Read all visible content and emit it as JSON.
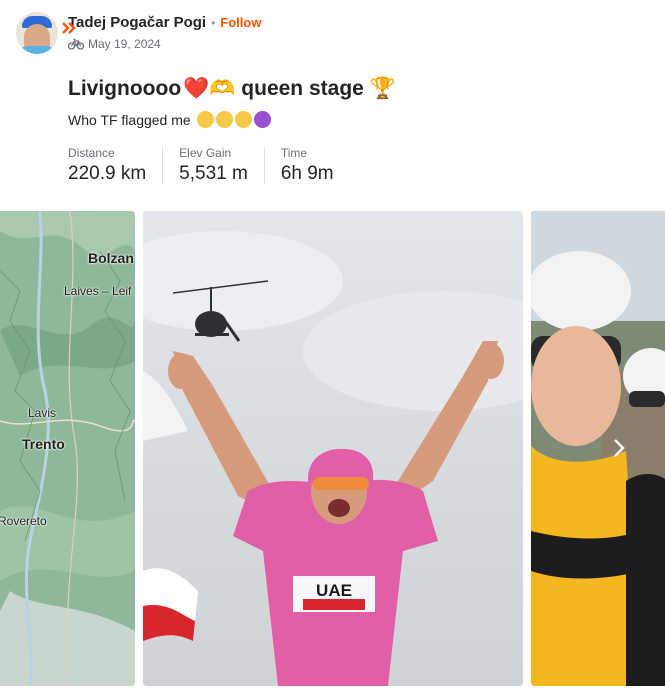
{
  "athlete": {
    "name": "Tadej Pogačar Pogi",
    "separator": "•",
    "follow_label": "Follow",
    "date": "May 19, 2024",
    "activity_icon": "bike-icon",
    "badge_icon": "subscriber-chevron-icon"
  },
  "activity": {
    "title": "Livignoooo",
    "title_emojis": "❤️🫶 queen stage 🏆",
    "description": "Who TF flagged me"
  },
  "stats": [
    {
      "label": "Distance",
      "value": "220.9 km"
    },
    {
      "label": "Elev Gain",
      "value": "5,531 m"
    },
    {
      "label": "Time",
      "value": "6h 9m"
    }
  ],
  "map": {
    "labels": [
      "Bolzan",
      "Laives – Leif",
      "Lavis",
      "Trento",
      "Rovereto"
    ]
  },
  "gallery": {
    "next_icon": "chevron-right-icon"
  },
  "colors": {
    "accent": "#fc5200",
    "text": "#242428",
    "muted": "#6d6d78",
    "jersey_pink": "#e05fa6",
    "map_green": "#8fb89a"
  }
}
